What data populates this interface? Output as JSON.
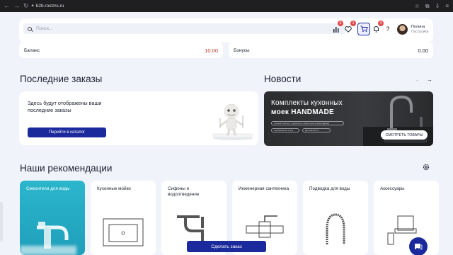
{
  "browser": {
    "url": "b2b.rostms.ru"
  },
  "search": {
    "placeholder": "Поиск..."
  },
  "header": {
    "compare_badge": "0",
    "favorites_badge": "1",
    "notifications_badge": "4",
    "help": "?",
    "user_name": "Полина",
    "user_sub": "Настройки"
  },
  "balance": {
    "label": "Баланс",
    "value": "10.00"
  },
  "bonuses": {
    "label": "Бонусы",
    "value": "0.00"
  },
  "orders": {
    "title": "Последние заказы",
    "message": "Здесь будут отображены ваши последние заказы",
    "catalog_button": "Перейти в каталог"
  },
  "news": {
    "title": "Новости",
    "banner_line1": "Комплекты кухонных",
    "banner_line2": "моек HANDMADE",
    "pill1": "Полный комплект с дозатором, смесителем и аксессуарами",
    "pill2": "Нержавеющая сталь",
    "pill3": "Долговечность",
    "shop_button": "СМОТРЕТЬ ТОВАРЫ"
  },
  "recommendations": {
    "title": "Наши рекомендации",
    "items": [
      {
        "label": "Смесители для воды"
      },
      {
        "label": "Кухонные мойки"
      },
      {
        "label": "Сифоны и водоотведение"
      },
      {
        "label": "Инженерная сантехника"
      },
      {
        "label": "Подводка для воды"
      },
      {
        "label": "Аксессуары"
      }
    ]
  },
  "footer": {
    "order_button": "Сделать заказ"
  },
  "colors": {
    "primary": "#1a2a9c",
    "accent_red": "#c0392b",
    "teal": "#2bb6cc",
    "background": "#f0f3f9"
  }
}
